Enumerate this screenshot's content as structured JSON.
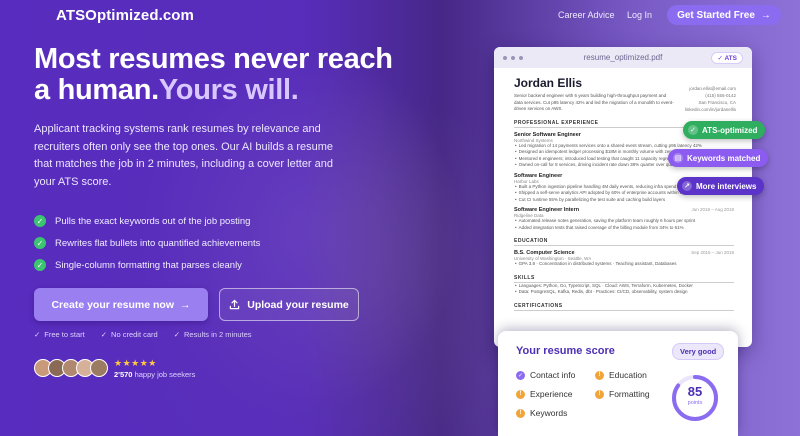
{
  "nav": {
    "logo": "ATSOptimized.com",
    "links": [
      "Career Advice",
      "Log In"
    ],
    "cta": "Get Started Free",
    "cta_arrow": "→"
  },
  "hero": {
    "headline_1": "Most resumes never reach",
    "headline_2": "a human.",
    "headline_accent": "Yours will.",
    "subcopy": "Applicant tracking systems rank resumes by relevance and recruiters often only see the top ones. Our AI builds a resume that matches the job in 2 minutes, including a cover letter and your ATS score.",
    "checks": [
      "Pulls the exact keywords out of the job posting",
      "Rewrites flat bullets into quantified achievements",
      "Single-column formatting that parses cleanly"
    ],
    "primary_button": "Create your resume now",
    "primary_arrow": "→",
    "secondary_button": "Upload your resume",
    "perks": [
      "Free to start",
      "No credit card",
      "Results in 2 minutes"
    ],
    "stars": "★★★★★",
    "seekers_count": "2'570",
    "seekers_label": "happy job seekers"
  },
  "colors": {
    "accent": "#8b6cf0",
    "brand_dark": "#4d2fb4",
    "success": "#2fae5f",
    "warning": "#f0a43a",
    "star": "#ffc83d"
  },
  "resume": {
    "file_name": "resume_optimized.pdf",
    "ats_pill": "ATS",
    "name": "Jordan Ellis",
    "contact": [
      "jordan.ellis@email.com",
      "(415) 555-0142",
      "San Francisco, CA",
      "linkedin.com/in/jordanellis"
    ],
    "summary": "Senior backend engineer with 6 years building high-throughput payment and data services. Cut p95 latency 42% and led the migration of a monolith to event-driven services on AWS.",
    "sections": {
      "experience": "PROFESSIONAL EXPERIENCE",
      "education": "EDUCATION",
      "skills": "SKILLS",
      "certifications": "CERTIFICATIONS"
    },
    "jobs": [
      {
        "title": "Senior Software Engineer",
        "company": "Northwind Systems",
        "date": "",
        "bullets": [
          "Led migration of 14 payments services onto a shared event stream, cutting p95 latency 42%",
          "Designed an idempotent ledger processing $18M in monthly volume with zero reconciliation",
          "Mentored 6 engineers; introduced load testing that caught 11 capacity regressions before release",
          "Owned on-call for 8 services, driving incident rate down 38% quarter over quarter"
        ]
      },
      {
        "title": "Software Engineer",
        "company": "Harbor Labs",
        "date": "",
        "bullets": [
          "Built a Python ingestion pipeline handling 4M daily events, reducing infra spend 27%",
          "Shipped a self-serve analytics API adopted by 60% of enterprise accounts within two quarters",
          "Cut CI runtime 55% by parallelizing the test suite and caching build layers"
        ]
      },
      {
        "title": "Software Engineer Intern",
        "company": "Ridgeline Data",
        "date": "Jun 2018 – Aug 2018",
        "bullets": [
          "Automated release notes generation, saving the platform team roughly 6 hours per sprint",
          "Added integration tests that raised coverage of the billing module from 34% to 61%"
        ]
      }
    ],
    "education": {
      "degree": "B.S. Computer Science",
      "school": "University of Washington · Seattle, WA",
      "date": "Sep 2015 – Jun 2019",
      "detail": "GPA 3.8 · Concentration in distributed systems · Teaching assistant, Databases"
    },
    "skills": [
      "Languages: Python, Go, TypeScript, SQL · Cloud: AWS, Terraform, Kubernetes, Docker",
      "Data: PostgreSQL, Kafka, Redis, dbt · Practices: CI/CD, observability, system design"
    ]
  },
  "badges": [
    {
      "label": "ATS-optimized",
      "icon": "check-icon"
    },
    {
      "label": "Keywords matched",
      "icon": "document-icon"
    },
    {
      "label": "More interviews",
      "icon": "trend-up-icon"
    }
  ],
  "score": {
    "title": "Your resume score",
    "rating": "Very good",
    "value": "85",
    "value_fraction": 0.85,
    "unit": "points",
    "criteria": [
      {
        "label": "Contact info",
        "status": "ok"
      },
      {
        "label": "Education",
        "status": "warn"
      },
      {
        "label": "Experience",
        "status": "warn"
      },
      {
        "label": "Formatting",
        "status": "warn"
      },
      {
        "label": "Keywords",
        "status": "warn"
      }
    ]
  }
}
